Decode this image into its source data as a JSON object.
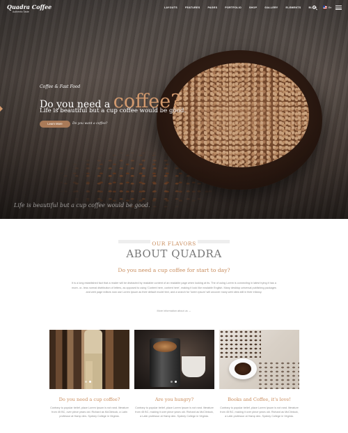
{
  "header": {
    "logo_title": "Quadra Coffee",
    "logo_subtitle": "Authentic Taste",
    "nav": [
      "LAYOUTS",
      "FEATURES",
      "PAGES",
      "PORTFOLIO",
      "SHOP",
      "GALLERY",
      "ELEMENTS",
      "BLOG"
    ],
    "language": "En",
    "icons": [
      "search-icon",
      "flag-icon",
      "menu-icon"
    ]
  },
  "hero": {
    "pre_title": "Coffee & Fast Food",
    "title_start": "Do you need a",
    "title_accent": "coffee?",
    "subtitle": "Life is beautiful but a cup coffee would be good.",
    "button_label": "Learn More",
    "secondary_link": "Do you want a coffee?",
    "caption": "Life is beautiful but a cup coffee would be good.",
    "accent_color": "#d39a6e"
  },
  "about": {
    "pre_title": "OUR FLAVORS",
    "title": "ABOUT QUADRA",
    "question": "Do you need a cup coffee for start to day?",
    "body": "It is a long established fact that a reader will be distracted by readable content of an readable page when looking at its. The of using Lorem is connecting in latest trying it has a more- or- less normal distribution of letters, as opposed to using 'Content here, content here', making it look like readable English. Many desktop universal publishing packages and web page editors now use Lorem Ipsum as their default model text, and a search for 'lorem ipsum' will uncover many web sites still in their infancy.",
    "more_link": "More information about us →"
  },
  "cards": [
    {
      "title": "Do you need a cup coffee?",
      "text": "Contrary to popular belief, place Lorem Ipsum is not rand. literature from 45 BC, over piece years old. Richard as McClintock, a Latin professor at Hamp den- Sydney College in Virginia."
    },
    {
      "title": "Are you hungry?",
      "text": "Contrary to popular belief, place Lorem Ipsum is not rand. literature from 45 BC, making it over piece years old. Richard as McClintock, a Latin professor at Hamp den- Sydney College in Virginia."
    },
    {
      "title": "Books and Coffee, it's love!",
      "text": "Contrary to popular belief, place Lorem Ipsum is not rand. literature from 45 BC, making it over piece years old. Richard as McClintock, a Latin professor at Hamp den- Sydney College in Virginia."
    }
  ]
}
